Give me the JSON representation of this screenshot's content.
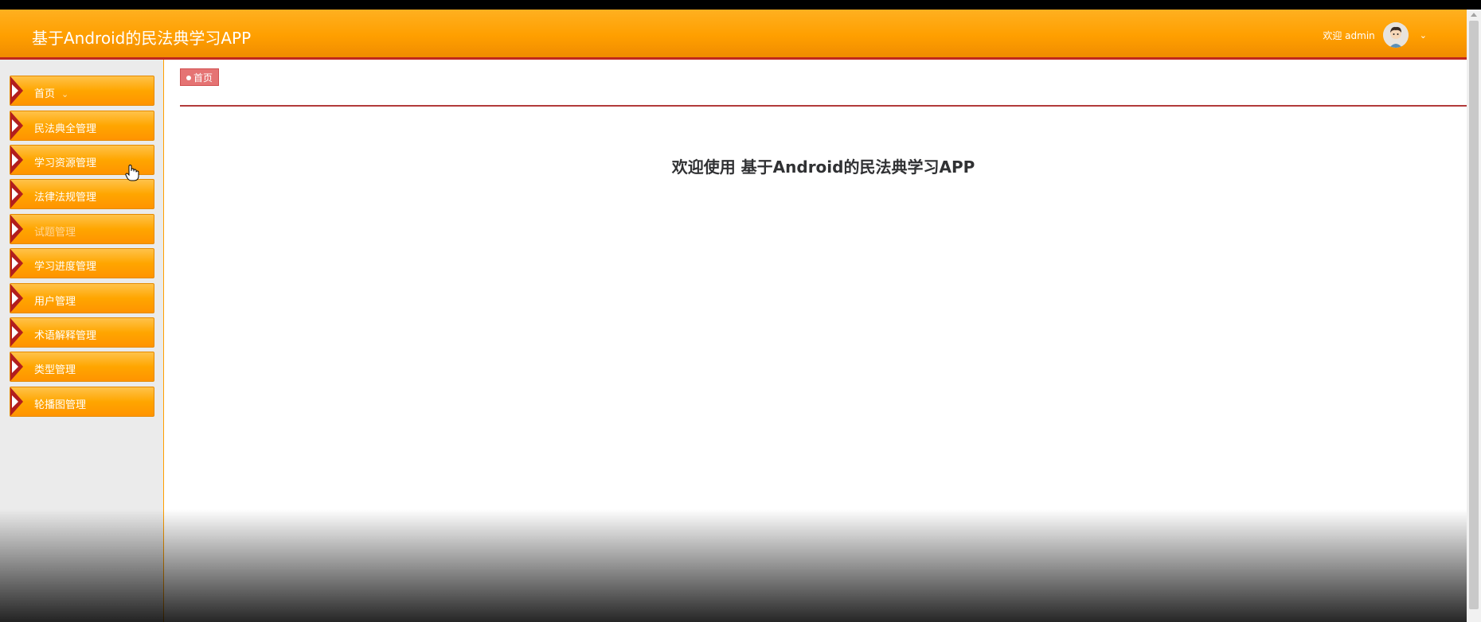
{
  "header": {
    "app_title": "基于Android的民法典学习APP",
    "welcome_text": "欢迎 admin",
    "user_menu_chevron": "⌄"
  },
  "sidebar": {
    "items": [
      {
        "label": "首页",
        "chevron": "⌄"
      },
      {
        "label": "民法典全管理"
      },
      {
        "label": "学习资源管理"
      },
      {
        "label": "法律法规管理"
      },
      {
        "label": "试题管理"
      },
      {
        "label": "学习进度管理"
      },
      {
        "label": "用户管理"
      },
      {
        "label": "术语解释管理"
      },
      {
        "label": "类型管理"
      },
      {
        "label": "轮播图管理"
      }
    ]
  },
  "breadcrumb": {
    "label": "首页"
  },
  "main": {
    "welcome_message": "欢迎使用 基于Android的民法典学习APP"
  },
  "icons": {
    "nav_marker": "nav-triangle-icon",
    "avatar": "avatar-icon",
    "cursor": "hand-pointer-icon"
  },
  "colors": {
    "header_bg": "#ff9f00",
    "header_border": "#c0281e",
    "nav_bg": "#ffa600",
    "nav_marker": "#b21e1e",
    "breadcrumb_bg": "#e57373",
    "divider": "#b23a3a",
    "title_text": "#303133"
  }
}
